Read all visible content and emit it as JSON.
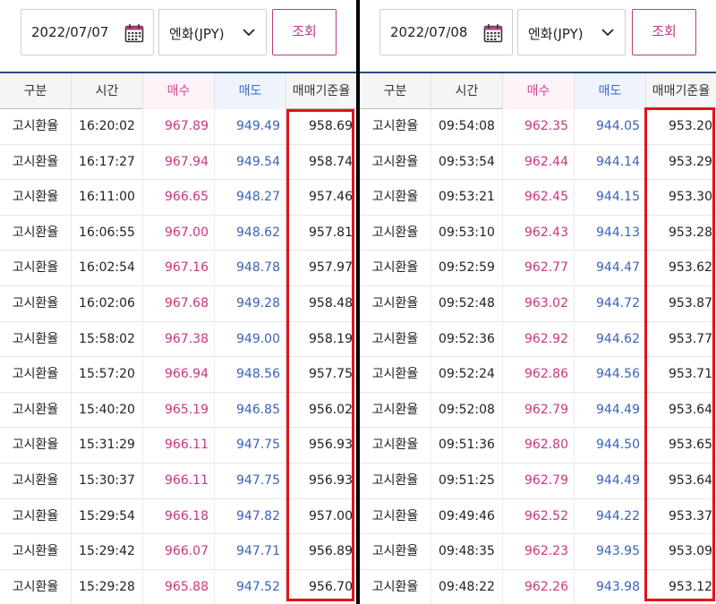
{
  "left": {
    "date": "2022/07/07",
    "currency": "엔화(JPY)",
    "search_label": "조회",
    "headers": [
      "구분",
      "시간",
      "매수",
      "매도",
      "매매기준율"
    ],
    "rows": [
      {
        "kind": "고시환율",
        "time": "16:20:02",
        "buy": "967.89",
        "sell": "949.49",
        "base": "958.69"
      },
      {
        "kind": "고시환율",
        "time": "16:17:27",
        "buy": "967.94",
        "sell": "949.54",
        "base": "958.74"
      },
      {
        "kind": "고시환율",
        "time": "16:11:00",
        "buy": "966.65",
        "sell": "948.27",
        "base": "957.46"
      },
      {
        "kind": "고시환율",
        "time": "16:06:55",
        "buy": "967.00",
        "sell": "948.62",
        "base": "957.81"
      },
      {
        "kind": "고시환율",
        "time": "16:02:54",
        "buy": "967.16",
        "sell": "948.78",
        "base": "957.97"
      },
      {
        "kind": "고시환율",
        "time": "16:02:06",
        "buy": "967.68",
        "sell": "949.28",
        "base": "958.48"
      },
      {
        "kind": "고시환율",
        "time": "15:58:02",
        "buy": "967.38",
        "sell": "949.00",
        "base": "958.19"
      },
      {
        "kind": "고시환율",
        "time": "15:57:20",
        "buy": "966.94",
        "sell": "948.56",
        "base": "957.75"
      },
      {
        "kind": "고시환율",
        "time": "15:40:20",
        "buy": "965.19",
        "sell": "946.85",
        "base": "956.02"
      },
      {
        "kind": "고시환율",
        "time": "15:31:29",
        "buy": "966.11",
        "sell": "947.75",
        "base": "956.93"
      },
      {
        "kind": "고시환율",
        "time": "15:30:37",
        "buy": "966.11",
        "sell": "947.75",
        "base": "956.93"
      },
      {
        "kind": "고시환율",
        "time": "15:29:54",
        "buy": "966.18",
        "sell": "947.82",
        "base": "957.00"
      },
      {
        "kind": "고시환율",
        "time": "15:29:42",
        "buy": "966.07",
        "sell": "947.71",
        "base": "956.89"
      },
      {
        "kind": "고시환율",
        "time": "15:29:28",
        "buy": "965.88",
        "sell": "947.52",
        "base": "956.70"
      }
    ]
  },
  "right": {
    "date": "2022/07/08",
    "currency": "엔화(JPY)",
    "search_label": "조회",
    "headers": [
      "구분",
      "시간",
      "매수",
      "매도",
      "매매기준율"
    ],
    "rows": [
      {
        "kind": "고시환율",
        "time": "09:54:08",
        "buy": "962.35",
        "sell": "944.05",
        "base": "953.20"
      },
      {
        "kind": "고시환율",
        "time": "09:53:54",
        "buy": "962.44",
        "sell": "944.14",
        "base": "953.29"
      },
      {
        "kind": "고시환율",
        "time": "09:53:21",
        "buy": "962.45",
        "sell": "944.15",
        "base": "953.30"
      },
      {
        "kind": "고시환율",
        "time": "09:53:10",
        "buy": "962.43",
        "sell": "944.13",
        "base": "953.28"
      },
      {
        "kind": "고시환율",
        "time": "09:52:59",
        "buy": "962.77",
        "sell": "944.47",
        "base": "953.62"
      },
      {
        "kind": "고시환율",
        "time": "09:52:48",
        "buy": "963.02",
        "sell": "944.72",
        "base": "953.87"
      },
      {
        "kind": "고시환율",
        "time": "09:52:36",
        "buy": "962.92",
        "sell": "944.62",
        "base": "953.77"
      },
      {
        "kind": "고시환율",
        "time": "09:52:24",
        "buy": "962.86",
        "sell": "944.56",
        "base": "953.71"
      },
      {
        "kind": "고시환율",
        "time": "09:52:08",
        "buy": "962.79",
        "sell": "944.49",
        "base": "953.64"
      },
      {
        "kind": "고시환율",
        "time": "09:51:36",
        "buy": "962.80",
        "sell": "944.50",
        "base": "953.65"
      },
      {
        "kind": "고시환율",
        "time": "09:51:25",
        "buy": "962.79",
        "sell": "944.49",
        "base": "953.64"
      },
      {
        "kind": "고시환율",
        "time": "09:49:46",
        "buy": "962.52",
        "sell": "944.22",
        "base": "953.37"
      },
      {
        "kind": "고시환율",
        "time": "09:48:35",
        "buy": "962.23",
        "sell": "943.95",
        "base": "953.09"
      },
      {
        "kind": "고시환율",
        "time": "09:48:22",
        "buy": "962.26",
        "sell": "943.98",
        "base": "953.12"
      }
    ]
  },
  "colors": {
    "accent": "#b83f86",
    "buy": "#c8377e",
    "sell": "#3a63b8",
    "highlight": "#e3121a",
    "header_border": "#2b4c7e"
  },
  "icons": {
    "calendar": "calendar-icon",
    "dropdown": "chevron-down-icon"
  }
}
